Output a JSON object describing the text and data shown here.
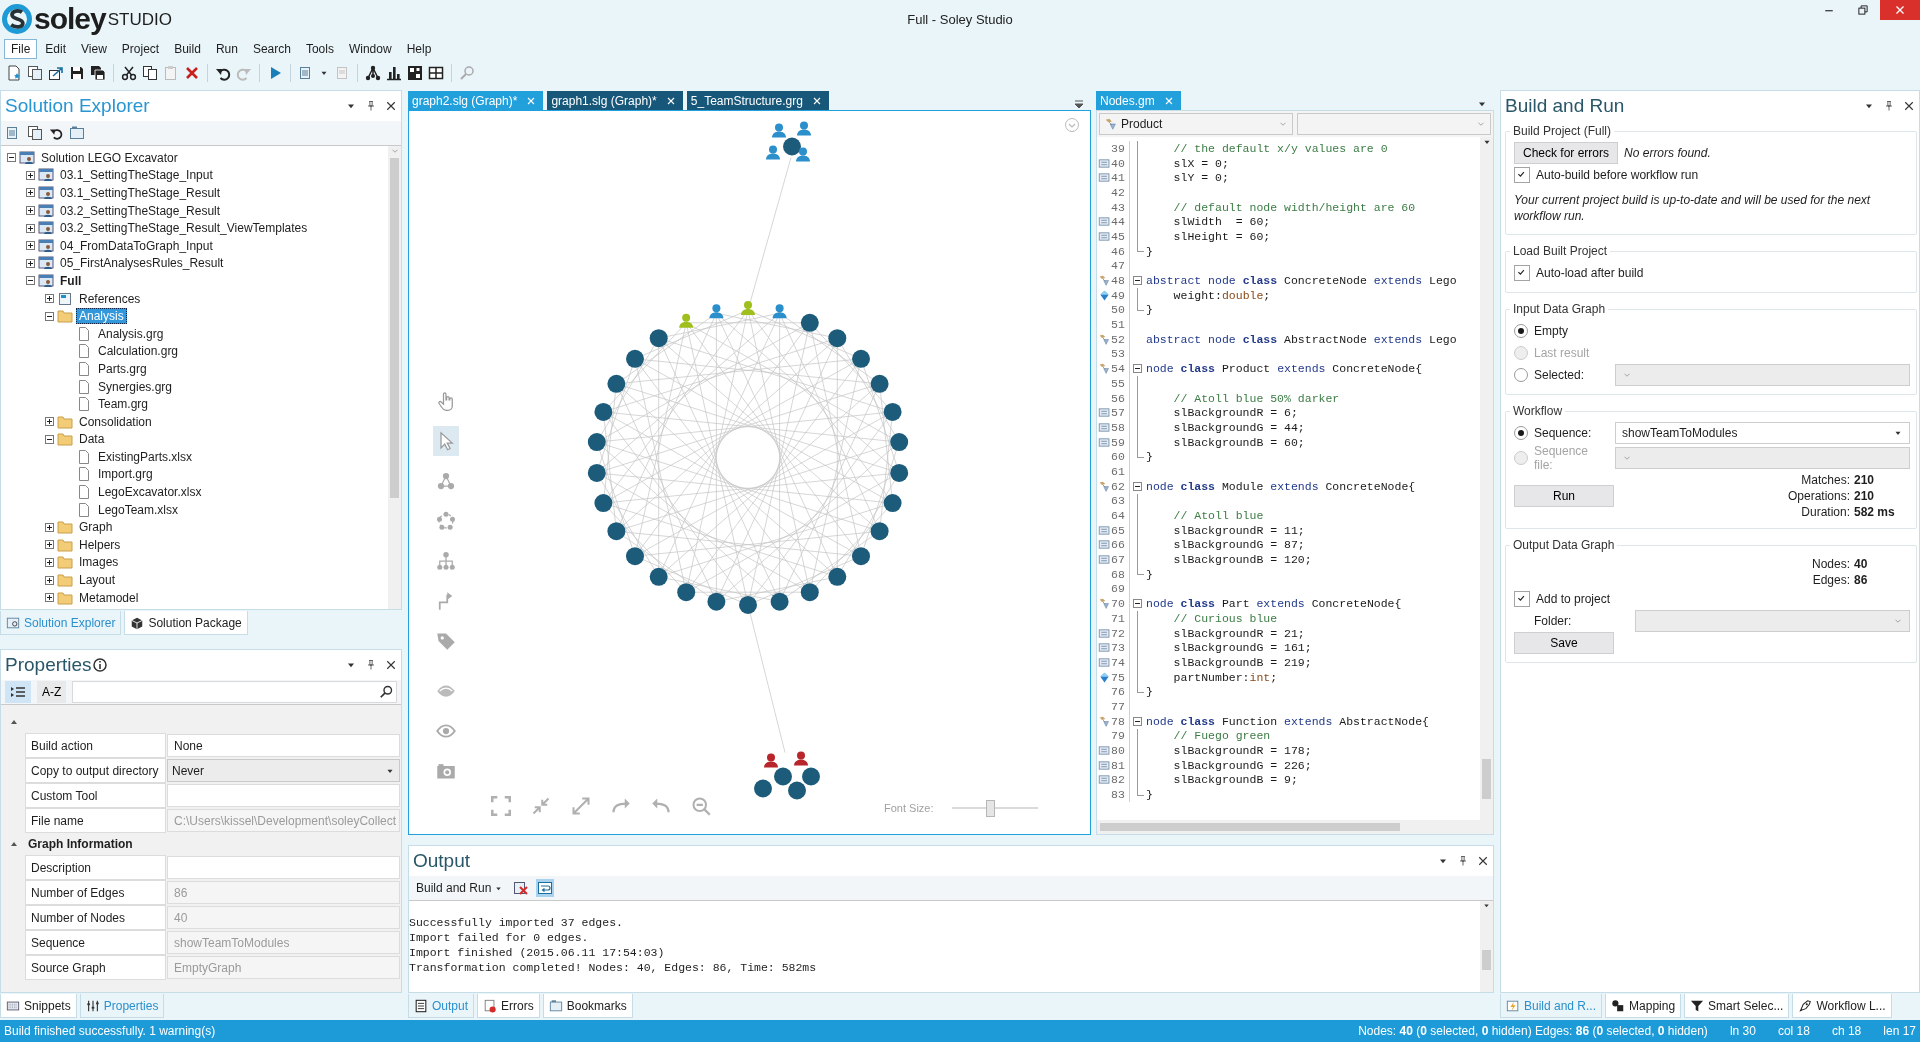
{
  "window": {
    "title": "Full - Soley Studio",
    "brand": {
      "name": "soley",
      "suffix": "STUDIO"
    }
  },
  "menu": [
    {
      "label": "File",
      "selected": true
    },
    {
      "label": "Edit",
      "selected": false
    },
    {
      "label": "View",
      "selected": false
    },
    {
      "label": "Project",
      "selected": false
    },
    {
      "label": "Build",
      "selected": false
    },
    {
      "label": "Run",
      "selected": false
    },
    {
      "label": "Search",
      "selected": false
    },
    {
      "label": "Tools",
      "selected": false
    },
    {
      "label": "Window",
      "selected": false
    },
    {
      "label": "Help",
      "selected": false
    }
  ],
  "solution_explorer": {
    "title": "Solution Explorer",
    "active": true,
    "tree": [
      {
        "label": "Solution LEGO Excavator",
        "kind": "solution",
        "expanded": true,
        "selected": false,
        "children": [
          {
            "label": "03.1_SettingTheStage_Input",
            "kind": "project",
            "expanded": false,
            "selected": false,
            "startup": false
          },
          {
            "label": "03.1_SettingTheStage_Result",
            "kind": "project",
            "expanded": false,
            "selected": false,
            "startup": false
          },
          {
            "label": "03.2_SettingTheStage_Result",
            "kind": "project",
            "expanded": false,
            "selected": false,
            "startup": false
          },
          {
            "label": "03.2_SettingTheStage_Result_ViewTemplates",
            "kind": "project",
            "expanded": false,
            "selected": false,
            "startup": false
          },
          {
            "label": "04_FromDataToGraph_Input",
            "kind": "project",
            "expanded": false,
            "selected": false,
            "startup": false
          },
          {
            "label": "05_FirstAnalysesRules_Result",
            "kind": "project",
            "expanded": false,
            "selected": false,
            "startup": false
          },
          {
            "label": "Full",
            "kind": "project",
            "expanded": true,
            "selected": false,
            "startup": true,
            "children": [
              {
                "label": "References",
                "kind": "references",
                "expanded": false,
                "selected": false
              },
              {
                "label": "Analysis",
                "kind": "folder",
                "expanded": true,
                "selected": true,
                "children": [
                  {
                    "label": "Analysis.grg",
                    "kind": "file",
                    "selected": false
                  },
                  {
                    "label": "Calculation.grg",
                    "kind": "file",
                    "selected": false
                  },
                  {
                    "label": "Parts.grg",
                    "kind": "file",
                    "selected": false
                  },
                  {
                    "label": "Synergies.grg",
                    "kind": "file",
                    "selected": false
                  },
                  {
                    "label": "Team.grg",
                    "kind": "file",
                    "selected": false
                  }
                ]
              },
              {
                "label": "Consolidation",
                "kind": "folder",
                "expanded": false,
                "selected": false
              },
              {
                "label": "Data",
                "kind": "folder",
                "expanded": true,
                "selected": false,
                "children": [
                  {
                    "label": "ExistingParts.xlsx",
                    "kind": "file",
                    "selected": false
                  },
                  {
                    "label": "Import.grg",
                    "kind": "file",
                    "selected": false
                  },
                  {
                    "label": "LegoExcavator.xlsx",
                    "kind": "file",
                    "selected": false
                  },
                  {
                    "label": "LegoTeam.xlsx",
                    "kind": "file",
                    "selected": false
                  }
                ]
              },
              {
                "label": "Graph",
                "kind": "folder",
                "expanded": false,
                "selected": false
              },
              {
                "label": "Helpers",
                "kind": "folder",
                "expanded": false,
                "selected": false
              },
              {
                "label": "Images",
                "kind": "folder",
                "expanded": false,
                "selected": false
              },
              {
                "label": "Layout",
                "kind": "folder",
                "expanded": false,
                "selected": false
              },
              {
                "label": "Metamodel",
                "kind": "folder",
                "expanded": false,
                "selected": false
              }
            ]
          }
        ]
      }
    ],
    "tabs": [
      {
        "label": "Solution Explorer",
        "kind": "explorer",
        "selected": true
      },
      {
        "label": "Solution Package",
        "kind": "package",
        "selected": false
      }
    ]
  },
  "properties": {
    "title": "Properties",
    "active": false,
    "view_buttons": [
      {
        "kind": "categorized",
        "selected": true
      },
      {
        "kind": "alphabetical",
        "label": "A-Z",
        "selected": false
      }
    ],
    "groups": [
      {
        "expanded": true,
        "rows": [
          {
            "name": "Build action",
            "value": "None",
            "kind": "text",
            "disabled": false
          },
          {
            "name": "Copy to output directory",
            "value": "Never",
            "kind": "dropdown",
            "disabled": false
          },
          {
            "name": "Custom Tool",
            "kind": "text",
            "disabled": false
          },
          {
            "name": "File name",
            "value": "C:\\Users\\kissel\\Development\\soleyCollect",
            "kind": "text",
            "disabled": true
          }
        ]
      },
      {
        "label": "Graph Information",
        "expanded": true,
        "rows": [
          {
            "name": "Description",
            "kind": "text",
            "disabled": false
          },
          {
            "name": "Number of Edges",
            "value": "86",
            "kind": "text",
            "disabled": true
          },
          {
            "name": "Number of Nodes",
            "value": "40",
            "kind": "text",
            "disabled": true
          },
          {
            "name": "Sequence",
            "value": "showTeamToModules",
            "kind": "text",
            "disabled": true
          },
          {
            "name": "Source Graph",
            "value": "EmptyGraph",
            "kind": "text",
            "disabled": true
          }
        ]
      }
    ],
    "tabs": [
      {
        "label": "Snippets",
        "kind": "snippets",
        "selected": false
      },
      {
        "label": "Properties",
        "kind": "properties",
        "selected": true
      }
    ]
  },
  "documents": {
    "tabs": [
      {
        "label": "graph2.slg (Graph)*",
        "selected": true
      },
      {
        "label": "graph1.slg (Graph)*",
        "selected": false
      },
      {
        "label": "5_TeamStructure.grg",
        "selected": false
      }
    ],
    "graph_tools": [
      {
        "kind": "hand",
        "selected": false
      },
      {
        "kind": "pointer",
        "selected": true
      },
      {
        "kind": "triangle",
        "selected": false
      },
      {
        "kind": "circle",
        "selected": false
      },
      {
        "kind": "tree",
        "selected": false
      },
      {
        "kind": "connector",
        "selected": false
      },
      {
        "kind": "tag",
        "selected": false
      },
      {
        "kind": "hide",
        "selected": false
      },
      {
        "kind": "show",
        "selected": false
      },
      {
        "kind": "camera",
        "selected": false
      }
    ],
    "font_size": {
      "label": "Font Size:",
      "level": 0.45
    }
  },
  "editor": {
    "tab": {
      "label": "Nodes.gm",
      "selected": true
    },
    "type_dropdown": "Product",
    "lines": [
      {
        "number": "39",
        "kind": "plain",
        "collapsible": false,
        "in_block": true,
        "tokens": [
          {
            "kind": "comment",
            "text": "    // the default x/y values are 0"
          }
        ]
      },
      {
        "number": "40",
        "kind": "member",
        "collapsible": false,
        "in_block": true,
        "tokens": [
          {
            "kind": "plain",
            "text": "    slX = 0;"
          }
        ]
      },
      {
        "number": "41",
        "kind": "member",
        "collapsible": false,
        "in_block": true,
        "tokens": [
          {
            "kind": "plain",
            "text": "    slY = 0;"
          }
        ]
      },
      {
        "number": "42",
        "kind": "plain",
        "collapsible": false,
        "in_block": true
      },
      {
        "number": "43",
        "kind": "plain",
        "collapsible": false,
        "in_block": true,
        "tokens": [
          {
            "kind": "comment",
            "text": "    // default node width/height are 60"
          }
        ]
      },
      {
        "number": "44",
        "kind": "member",
        "collapsible": false,
        "in_block": true,
        "tokens": [
          {
            "kind": "plain",
            "text": "    slWidth  = 60;"
          }
        ]
      },
      {
        "number": "45",
        "kind": "member",
        "collapsible": false,
        "in_block": true,
        "tokens": [
          {
            "kind": "plain",
            "text": "    slHeight = 60;"
          }
        ]
      },
      {
        "number": "46",
        "kind": "plain",
        "collapsible": false,
        "in_block": true,
        "tokens": [
          {
            "kind": "plain",
            "text": "}"
          }
        ]
      },
      {
        "number": "47",
        "kind": "plain",
        "collapsible": false,
        "in_block": false
      },
      {
        "number": "48",
        "kind": "class",
        "collapsible": true,
        "in_block": false,
        "tokens": [
          {
            "kind": "keyword",
            "text": "abstract node "
          },
          {
            "kind": "strong",
            "text": "class"
          },
          {
            "kind": "plain",
            "text": " ConcreteNode "
          },
          {
            "kind": "keyword",
            "text": "extends"
          },
          {
            "kind": "plain",
            "text": " Lego"
          }
        ]
      },
      {
        "number": "49",
        "kind": "attribute",
        "collapsible": false,
        "in_block": true,
        "tokens": [
          {
            "kind": "plain",
            "text": "    weight:"
          },
          {
            "kind": "type",
            "text": "double"
          },
          {
            "kind": "plain",
            "text": ";"
          }
        ]
      },
      {
        "number": "50",
        "kind": "plain",
        "collapsible": false,
        "in_block": true,
        "tokens": [
          {
            "kind": "plain",
            "text": "}"
          }
        ]
      },
      {
        "number": "51",
        "kind": "plain",
        "collapsible": false,
        "in_block": false
      },
      {
        "number": "52",
        "kind": "class",
        "collapsible": false,
        "in_block": false,
        "tokens": [
          {
            "kind": "keyword",
            "text": "abstract node "
          },
          {
            "kind": "strong",
            "text": "class"
          },
          {
            "kind": "plain",
            "text": " AbstractNode "
          },
          {
            "kind": "keyword",
            "text": "extends"
          },
          {
            "kind": "plain",
            "text": " Lego"
          }
        ]
      },
      {
        "number": "53",
        "kind": "plain",
        "collapsible": false,
        "in_block": false
      },
      {
        "number": "54",
        "kind": "class",
        "collapsible": true,
        "in_block": false,
        "tokens": [
          {
            "kind": "keyword",
            "text": "node "
          },
          {
            "kind": "strong",
            "text": "class"
          },
          {
            "kind": "plain",
            "text": " Product "
          },
          {
            "kind": "keyword",
            "text": "extends"
          },
          {
            "kind": "plain",
            "text": " ConcreteNode{"
          }
        ]
      },
      {
        "number": "55",
        "kind": "plain",
        "collapsible": false,
        "in_block": true
      },
      {
        "number": "56",
        "kind": "plain",
        "collapsible": false,
        "in_block": true,
        "tokens": [
          {
            "kind": "comment",
            "text": "    // Atoll blue 50% darker"
          }
        ]
      },
      {
        "number": "57",
        "kind": "member",
        "collapsible": false,
        "in_block": true,
        "tokens": [
          {
            "kind": "plain",
            "text": "    slBackgroundR = 6;"
          }
        ]
      },
      {
        "number": "58",
        "kind": "member",
        "collapsible": false,
        "in_block": true,
        "tokens": [
          {
            "kind": "plain",
            "text": "    slBackgroundG = 44;"
          }
        ]
      },
      {
        "number": "59",
        "kind": "member",
        "collapsible": false,
        "in_block": true,
        "tokens": [
          {
            "kind": "plain",
            "text": "    slBackgroundB = 60;"
          }
        ]
      },
      {
        "number": "60",
        "kind": "plain",
        "collapsible": false,
        "in_block": true,
        "tokens": [
          {
            "kind": "plain",
            "text": "}"
          }
        ]
      },
      {
        "number": "61",
        "kind": "plain",
        "collapsible": false,
        "in_block": false
      },
      {
        "number": "62",
        "kind": "class",
        "collapsible": true,
        "in_block": false,
        "tokens": [
          {
            "kind": "keyword",
            "text": "node "
          },
          {
            "kind": "strong",
            "text": "class"
          },
          {
            "kind": "plain",
            "text": " Module "
          },
          {
            "kind": "keyword",
            "text": "extends"
          },
          {
            "kind": "plain",
            "text": " ConcreteNode{"
          }
        ]
      },
      {
        "number": "63",
        "kind": "plain",
        "collapsible": false,
        "in_block": true
      },
      {
        "number": "64",
        "kind": "plain",
        "collapsible": false,
        "in_block": true,
        "tokens": [
          {
            "kind": "comment",
            "text": "    // Atoll blue"
          }
        ]
      },
      {
        "number": "65",
        "kind": "member",
        "collapsible": false,
        "in_block": true,
        "tokens": [
          {
            "kind": "plain",
            "text": "    slBackgroundR = 11;"
          }
        ]
      },
      {
        "number": "66",
        "kind": "member",
        "collapsible": false,
        "in_block": true,
        "tokens": [
          {
            "kind": "plain",
            "text": "    slBackgroundG = 87;"
          }
        ]
      },
      {
        "number": "67",
        "kind": "member",
        "collapsible": false,
        "in_block": true,
        "tokens": [
          {
            "kind": "plain",
            "text": "    slBackgroundB = 120;"
          }
        ]
      },
      {
        "number": "68",
        "kind": "plain",
        "collapsible": false,
        "in_block": true,
        "tokens": [
          {
            "kind": "plain",
            "text": "}"
          }
        ]
      },
      {
        "number": "69",
        "kind": "plain",
        "collapsible": false,
        "in_block": false
      },
      {
        "number": "70",
        "kind": "class",
        "collapsible": true,
        "in_block": false,
        "tokens": [
          {
            "kind": "keyword",
            "text": "node "
          },
          {
            "kind": "strong",
            "text": "class"
          },
          {
            "kind": "plain",
            "text": " Part "
          },
          {
            "kind": "keyword",
            "text": "extends"
          },
          {
            "kind": "plain",
            "text": " ConcreteNode{"
          }
        ]
      },
      {
        "number": "71",
        "kind": "plain",
        "collapsible": false,
        "in_block": true,
        "tokens": [
          {
            "kind": "comment",
            "text": "    // Curious blue"
          }
        ]
      },
      {
        "number": "72",
        "kind": "member",
        "collapsible": false,
        "in_block": true,
        "tokens": [
          {
            "kind": "plain",
            "text": "    slBackgroundR = 21;"
          }
        ]
      },
      {
        "number": "73",
        "kind": "member",
        "collapsible": false,
        "in_block": true,
        "tokens": [
          {
            "kind": "plain",
            "text": "    slBackgroundG = 161;"
          }
        ]
      },
      {
        "number": "74",
        "kind": "member",
        "collapsible": false,
        "in_block": true,
        "tokens": [
          {
            "kind": "plain",
            "text": "    slBackgroundB = 219;"
          }
        ]
      },
      {
        "number": "75",
        "kind": "attribute",
        "collapsible": false,
        "in_block": true,
        "tokens": [
          {
            "kind": "plain",
            "text": "    partNumber:"
          },
          {
            "kind": "type",
            "text": "int"
          },
          {
            "kind": "plain",
            "text": ";"
          }
        ]
      },
      {
        "number": "76",
        "kind": "plain",
        "collapsible": false,
        "in_block": true,
        "tokens": [
          {
            "kind": "plain",
            "text": "}"
          }
        ]
      },
      {
        "number": "77",
        "kind": "plain",
        "collapsible": false,
        "in_block": false
      },
      {
        "number": "78",
        "kind": "class",
        "collapsible": true,
        "in_block": false,
        "tokens": [
          {
            "kind": "keyword",
            "text": "node "
          },
          {
            "kind": "strong",
            "text": "class"
          },
          {
            "kind": "plain",
            "text": " Function "
          },
          {
            "kind": "keyword",
            "text": "extends"
          },
          {
            "kind": "plain",
            "text": " AbstractNode{"
          }
        ]
      },
      {
        "number": "79",
        "kind": "plain",
        "collapsible": false,
        "in_block": true,
        "tokens": [
          {
            "kind": "comment",
            "text": "    // Fuego green"
          }
        ]
      },
      {
        "number": "80",
        "kind": "member",
        "collapsible": false,
        "in_block": true,
        "tokens": [
          {
            "kind": "plain",
            "text": "    slBackgroundR = 178;"
          }
        ]
      },
      {
        "number": "81",
        "kind": "member",
        "collapsible": false,
        "in_block": true,
        "tokens": [
          {
            "kind": "plain",
            "text": "    slBackgroundG = 226;"
          }
        ]
      },
      {
        "number": "82",
        "kind": "member",
        "collapsible": false,
        "in_block": true,
        "tokens": [
          {
            "kind": "plain",
            "text": "    slBackgroundB = 9;"
          }
        ]
      },
      {
        "number": "83",
        "kind": "plain",
        "collapsible": false,
        "in_block": true,
        "tokens": [
          {
            "kind": "plain",
            "text": "}"
          }
        ]
      }
    ]
  },
  "output": {
    "title": "Output",
    "active": false,
    "source": "Build and Run",
    "word_wrap": true,
    "lines": [
      "Successfully imported 37 edges.",
      "Import failed for 0 edges.",
      "Import finished (2015.06.11 17:54:03)",
      "Transformation completed! Nodes: 40, Edges: 86, Time: 582ms"
    ],
    "tabs": [
      {
        "label": "Output",
        "kind": "output",
        "selected": true
      },
      {
        "label": "Errors",
        "kind": "errors",
        "selected": false
      },
      {
        "label": "Bookmarks",
        "kind": "bookmarks",
        "selected": false
      }
    ]
  },
  "build_run": {
    "title": "Build and Run",
    "active": false,
    "build_project": {
      "title": "Build Project (Full)",
      "check_button": "Check for errors",
      "result": "No errors found.",
      "auto_build": {
        "label": "Auto-build before workflow run",
        "checked": true
      },
      "note": "Your current project build is up-to-date and will be used for the next workflow run."
    },
    "load_built_project": {
      "title": "Load Built Project",
      "auto_load": {
        "label": "Auto-load after build",
        "checked": true
      }
    },
    "input_data_graph": {
      "title": "Input Data Graph",
      "options": [
        {
          "label": "Empty",
          "kind": "plain",
          "selected": true,
          "disabled": false
        },
        {
          "label": "Last result",
          "kind": "plain",
          "selected": false,
          "disabled": true
        },
        {
          "label": "Selected:",
          "kind": "dropdown",
          "selected": false,
          "disabled": false
        }
      ]
    },
    "workflow": {
      "title": "Workflow",
      "options": [
        {
          "label": "Sequence:",
          "kind": "dropdown",
          "value": "showTeamToModules",
          "selected": true,
          "disabled": false
        },
        {
          "label": "Sequence file:",
          "kind": "dropdown",
          "selected": false,
          "disabled": true
        }
      ],
      "run_button": "Run",
      "stats": [
        {
          "label": "Matches:",
          "value": "210"
        },
        {
          "label": "Operations:",
          "value": "210"
        },
        {
          "label": "Duration:",
          "value": "582 ms"
        }
      ]
    },
    "output_data_graph": {
      "title": "Output Data Graph",
      "stats": [
        {
          "label": "Nodes:",
          "value": "40"
        },
        {
          "label": "Edges:",
          "value": "86"
        }
      ],
      "add_to_project": {
        "label": "Add to project",
        "checked": true
      },
      "folder": {
        "label": "Folder:",
        "disabled": true
      },
      "save_button": "Save"
    },
    "tabs": [
      {
        "label": "Build and R...",
        "kind": "build",
        "selected": true
      },
      {
        "label": "Mapping",
        "kind": "mapping",
        "selected": false
      },
      {
        "label": "Smart Selec...",
        "kind": "filter",
        "selected": false
      },
      {
        "label": "Workflow L...",
        "kind": "workflow",
        "selected": false
      }
    ]
  },
  "status_bar": {
    "message": "Build finished successfully. 1 warning(s)",
    "stats": "Nodes: **40** (**0** selected, **0** hidden) Edges: **86** (**0** selected, **0** hidden)",
    "position": [
      "ln 30",
      "col 18",
      "ch 18",
      "len 17"
    ]
  }
}
